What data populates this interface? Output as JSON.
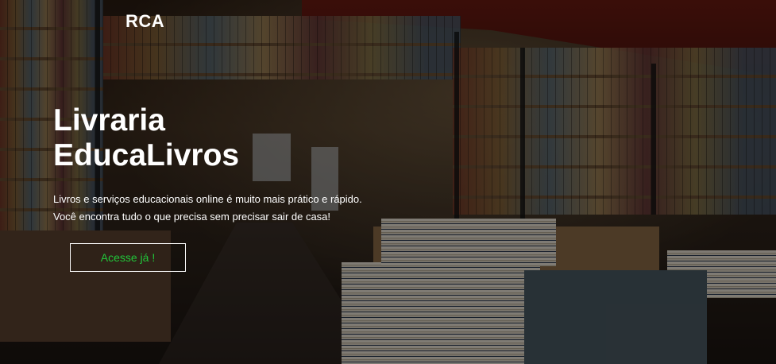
{
  "brand": {
    "name": "RCA"
  },
  "hero": {
    "title_line1": "Livraria",
    "title_line2": "EducaLivros",
    "subtitle_line1": "Livros e serviços educacionais online é muito mais prático e rápido.",
    "subtitle_line2": "Você encontra tudo o que precisa sem precisar sair de casa!",
    "cta_label": "Acesse já !"
  },
  "colors": {
    "cta_text": "#21c63a",
    "text": "#ffffff"
  }
}
